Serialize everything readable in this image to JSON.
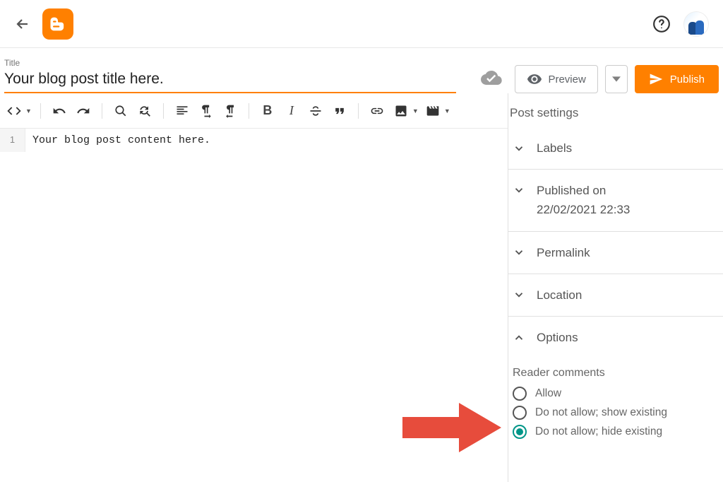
{
  "header": {
    "title_label": "Title",
    "title_value": "Your blog post title here.",
    "preview_label": "Preview",
    "publish_label": "Publish"
  },
  "editor": {
    "line_number": "1",
    "content": "Your blog post content here."
  },
  "sidebar": {
    "title": "Post settings",
    "labels": "Labels",
    "published_line1": "Published on",
    "published_line2": "22/02/2021 22:33",
    "permalink": "Permalink",
    "location": "Location",
    "options": "Options",
    "reader_comments_title": "Reader comments",
    "radio_allow": "Allow",
    "radio_show": "Do not allow; show existing",
    "radio_hide": "Do not allow; hide existing"
  }
}
